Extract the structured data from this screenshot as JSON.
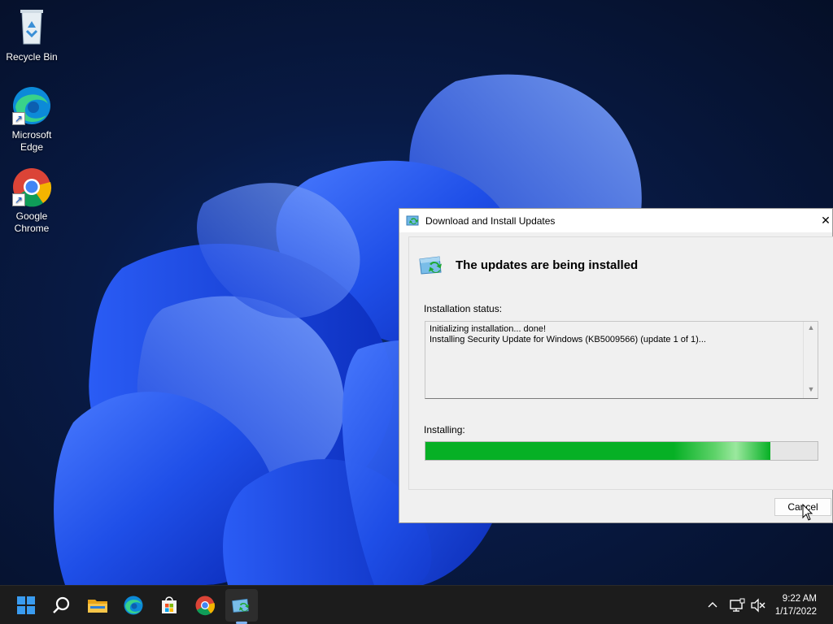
{
  "desktop": {
    "icons": [
      {
        "label": "Recycle Bin"
      },
      {
        "label_line1": "Microsoft",
        "label_line2": "Edge"
      },
      {
        "label_line1": "Google",
        "label_line2": "Chrome"
      }
    ]
  },
  "dialog": {
    "title": "Download and Install Updates",
    "close_glyph": "✕",
    "header": "The updates are being installed",
    "status_label": "Installation status:",
    "status_lines": [
      "Initializing installation... done!",
      "Installing Security Update for Windows (KB5009566) (update 1 of 1)..."
    ],
    "progress_label": "Installing:",
    "progress_fraction": 0.88,
    "cancel_label": "Cancel",
    "colors": {
      "progress": "#06b025"
    }
  },
  "taskbar": {
    "apps": [
      "start-icon",
      "search-icon",
      "file-explorer-icon",
      "edge-icon",
      "store-icon",
      "chrome-icon",
      "windows-update-icon"
    ],
    "clock_time": "9:22 AM",
    "clock_date": "1/17/2022",
    "tray_chevron": "^"
  }
}
